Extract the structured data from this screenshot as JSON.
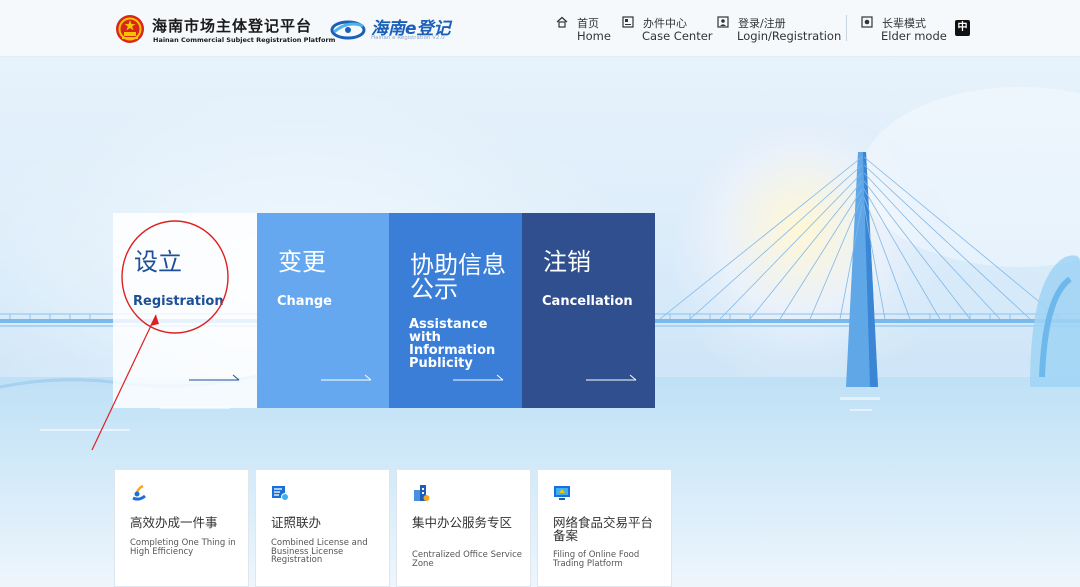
{
  "header": {
    "platform_name_cn": "海南市场主体登记平台",
    "platform_name_en": "Hainan Commercial Subject Registration Platform",
    "e_logo_cn": "海南e登记",
    "e_logo_en": "Hainan e Registration V2.0",
    "nav": [
      {
        "cn": "首页",
        "en": "Home",
        "icon": "home-icon"
      },
      {
        "cn": "办件中心",
        "en": "Case Center",
        "icon": "case-center-icon"
      },
      {
        "cn": "登录/注册",
        "en": "Login/Registration",
        "icon": "user-login-icon"
      },
      {
        "cn": "长辈模式",
        "en": "Elder mode",
        "icon": "elder-mode-icon"
      }
    ],
    "language_toggle": "中"
  },
  "cards": [
    {
      "cn": "设立",
      "en": "Registration"
    },
    {
      "cn": "变更",
      "en": "Change"
    },
    {
      "cn": "协助信息公示",
      "en": "Assistance with Information Publicity"
    },
    {
      "cn": "注销",
      "en": "Cancellation"
    }
  ],
  "tiles": [
    {
      "cn": "高效办成一件事",
      "en": "Completing One Thing in High Efficiency",
      "icon": "efficiency-icon"
    },
    {
      "cn": "证照联办",
      "en": "Combined License and Business License Registration",
      "icon": "license-icon"
    },
    {
      "cn": "集中办公服务专区",
      "en": "Centralized Office Service Zone",
      "icon": "office-building-icon"
    },
    {
      "cn": "网络食品交易平台备案",
      "en": "Filing of Online Food Trading Platform",
      "icon": "computer-icon"
    }
  ],
  "colors": {
    "primary": "#1b5fb8",
    "card_light": "#65a8ef",
    "card_mid": "#3a7ed8",
    "card_dark": "#2f4f8e",
    "annotation_red": "#e02020"
  }
}
